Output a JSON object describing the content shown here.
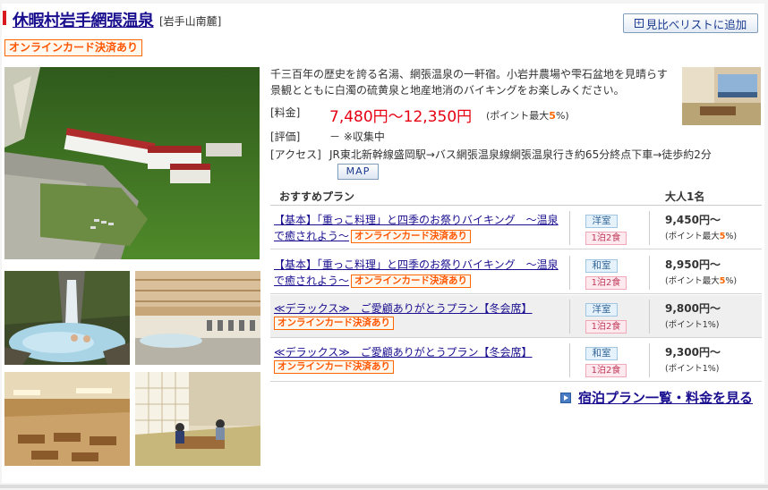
{
  "header": {
    "hotel_name": "休暇村岩手網張温泉",
    "area": "[岩手山南麓]",
    "compare_button": "見比べリストに追加",
    "online_card_badge": "オンラインカード決済あり"
  },
  "description": "千三百年の歴史を誇る名湯、網張温泉の一軒宿。小岩井農場や雫石盆地を見晴らす景観とともに白濁の硫黄泉と地産地消のバイキングをお楽しみください。",
  "info": {
    "price_label": "[料金]",
    "price_value": "7,480円～12,350円",
    "price_point": "(ポイント最大",
    "price_point_rate": "5",
    "price_point_unit": "%)",
    "rating_label": "[評価]",
    "rating_value": "－ ※収集中",
    "access_label": "[アクセス]",
    "access_value": "JR東北新幹線盛岡駅→バス網張温泉線網張温泉行き約65分終点下車→徒歩約2分",
    "map_button": "MAP"
  },
  "plans": {
    "header_plan": "おすすめプラン",
    "header_price": "大人1名",
    "rows": [
      {
        "name": "【基本】「重っこ料理」と四季のお祭りバイキング　～温泉で癒されよう～",
        "badge": "オンラインカード決済あり",
        "room": "洋室",
        "meal": "1泊2食",
        "price": "9,450円～",
        "point": "(ポイント最大",
        "point_rate": "5",
        "point_unit": "%)"
      },
      {
        "name": "【基本】「重っこ料理」と四季のお祭りバイキング　～温泉で癒されよう～",
        "badge": "オンラインカード決済あり",
        "room": "和室",
        "meal": "1泊2食",
        "price": "8,950円～",
        "point": "(ポイント最大",
        "point_rate": "5",
        "point_unit": "%)"
      },
      {
        "name": "≪デラックス≫　ご愛顧ありがとうプラン【冬会席】",
        "badge": "オンラインカード決済あり",
        "room": "洋室",
        "meal": "1泊2食",
        "price": "9,800円～",
        "point": "(ポイント1%)"
      },
      {
        "name": "≪デラックス≫　ご愛顧ありがとうプラン【冬会席】",
        "badge": "オンラインカード決済あり",
        "room": "和室",
        "meal": "1泊2食",
        "price": "9,300円～",
        "point": "(ポイント1%)"
      }
    ],
    "all_plans_link": "宿泊プラン一覧・料金を見る"
  },
  "colors": {
    "link": "#1a0f8f",
    "price_red": "#e60012",
    "badge_orange": "#ff6600"
  }
}
